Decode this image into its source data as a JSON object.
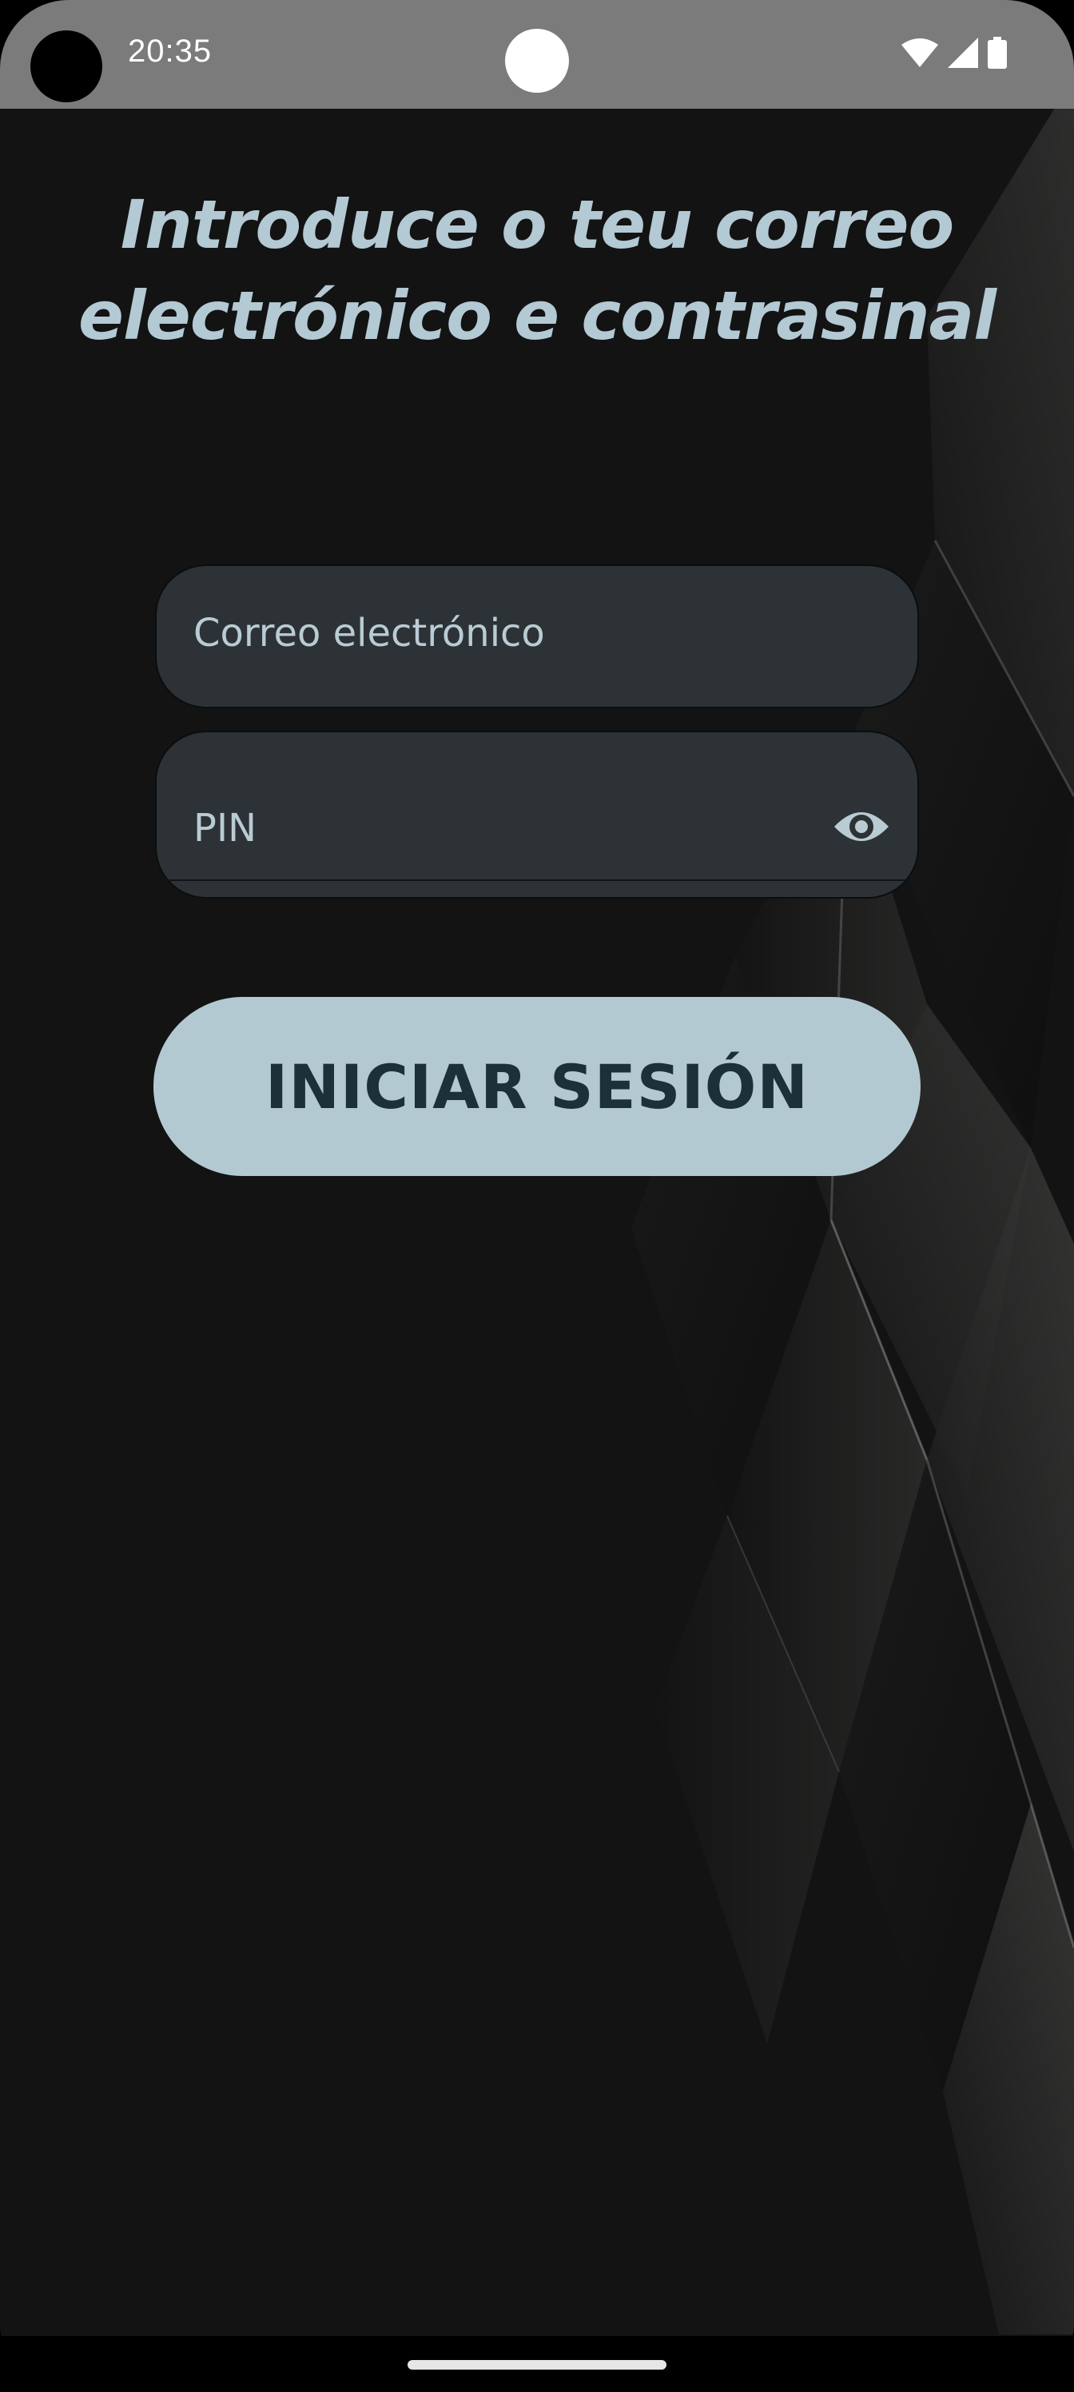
{
  "status_bar": {
    "time": "20:35",
    "icons": [
      "camera-cutout",
      "wifi-icon",
      "signal-icon",
      "battery-icon"
    ]
  },
  "login": {
    "heading_line1": "Introduce o teu correo",
    "heading_line2": "electrónico e contrasinal",
    "email_placeholder": "Correo electrónico",
    "pin_placeholder": "PIN",
    "pin_toggle_icon": "eye-icon",
    "submit_label": "INICIAR SESIÓN"
  },
  "colors": {
    "background": "#131313",
    "accent": "#b3c9d2",
    "field_background": "#2c3236",
    "button_text": "#1c3038",
    "status_bar": "#7b7b7b"
  }
}
